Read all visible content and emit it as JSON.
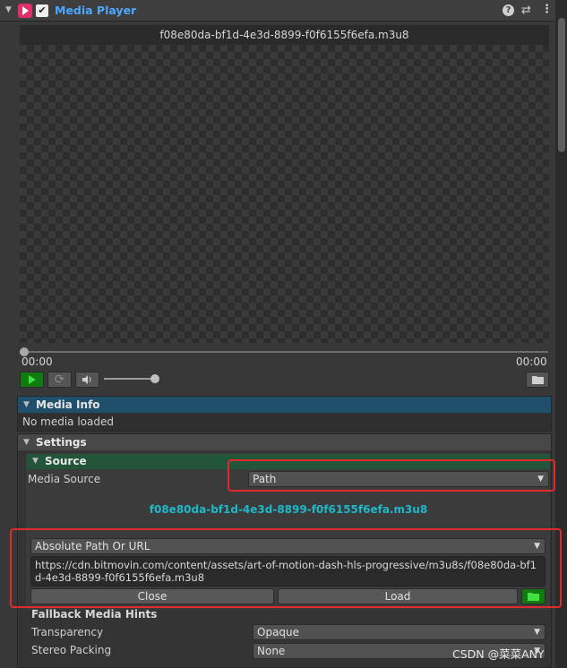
{
  "header": {
    "title": "Media Player",
    "enabled": true,
    "icons": [
      "media-player-logo-icon",
      "help-icon",
      "preset-settings-icon",
      "more-options-icon"
    ]
  },
  "player": {
    "filename": "f08e80da-bf1d-4e3d-8899-f0f6155f6efa.m3u8",
    "current_time": "00:00",
    "duration": "00:00",
    "seek_position": 0,
    "volume": 1.0
  },
  "media_info": {
    "title": "Media Info",
    "status": "No media loaded"
  },
  "settings": {
    "title": "Settings",
    "source": {
      "title": "Source",
      "media_source_label": "Media Source",
      "media_source_value": "Path",
      "path_display": "f08e80da-bf1d-4e3d-8899-f0f6155f6efa.m3u8",
      "path_type": "Absolute Path Or URL",
      "url": "https://cdn.bitmovin.com/content/assets/art-of-motion-dash-hls-progressive/m3u8s/f08e80da-bf1d-4e3d-8899-f0f6155f6efa.m3u8",
      "close_label": "Close",
      "load_label": "Load"
    },
    "fallback": {
      "title": "Fallback Media Hints",
      "transparency_label": "Transparency",
      "transparency_value": "Opaque",
      "stereo_label": "Stereo Packing",
      "stereo_value": "None"
    }
  },
  "watermark": "CSDN @菜菜ANY",
  "colors": {
    "accent_blue": "#4aa8ff",
    "path_cyan": "#1fb8c8",
    "highlight_red": "#e22a2a",
    "media_info_header": "#1f4f6b",
    "source_header": "#23553a",
    "play_green": "#117a11"
  }
}
